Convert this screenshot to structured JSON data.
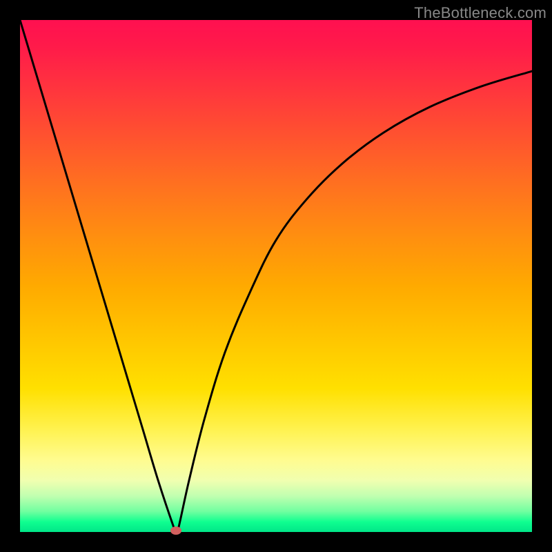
{
  "watermark": "TheBottleneck.com",
  "chart_data": {
    "type": "line",
    "title": "",
    "xlabel": "",
    "ylabel": "",
    "x": [
      0.0,
      0.03,
      0.06,
      0.09,
      0.12,
      0.15,
      0.18,
      0.21,
      0.24,
      0.27,
      0.3,
      0.305,
      0.31,
      0.33,
      0.36,
      0.4,
      0.45,
      0.5,
      0.56,
      0.63,
      0.71,
      0.8,
      0.9,
      1.0
    ],
    "values": [
      1.0,
      0.9,
      0.8,
      0.7,
      0.6,
      0.5,
      0.4,
      0.3,
      0.2,
      0.1,
      0.01,
      0.0,
      0.01,
      0.1,
      0.22,
      0.35,
      0.47,
      0.57,
      0.65,
      0.72,
      0.78,
      0.83,
      0.87,
      0.9
    ],
    "xlim": [
      0,
      1
    ],
    "ylim": [
      0,
      1
    ],
    "marker": {
      "x": 0.305,
      "y": 0.0
    },
    "gradient": {
      "top": "#ff1050",
      "bottom": "#00e688"
    }
  }
}
